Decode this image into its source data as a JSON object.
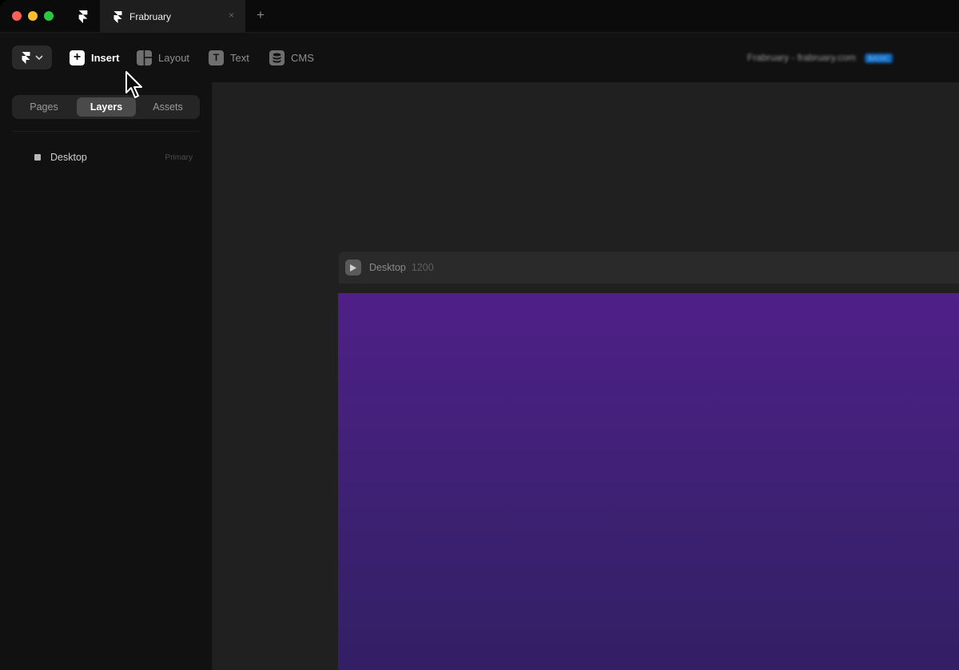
{
  "tabbar": {
    "doc_tab_label": "Frabruary",
    "close_glyph": "×",
    "new_tab_glyph": "+"
  },
  "toolbar": {
    "menu_chevron": "⌄",
    "insert_label": "Insert",
    "layout_label": "Layout",
    "text_label": "Text",
    "cms_label": "CMS",
    "text_icon_glyph": "T",
    "insert_icon_glyph": "+",
    "project_name": "Frabruary",
    "project_separator": " - ",
    "project_domain": "frabruary.com",
    "project_badge": "BASIC"
  },
  "sidebar": {
    "tabs": {
      "pages": "Pages",
      "layers": "Layers",
      "assets": "Assets"
    },
    "active_tab": "Layers",
    "layers": [
      {
        "name": "Desktop",
        "tag": "Primary"
      }
    ]
  },
  "canvas": {
    "frame_name": "Desktop",
    "frame_width_label": "1200"
  },
  "colors": {
    "accent_badge": "#0b63b6",
    "frame_top": "#4f2088",
    "frame_bottom": "#331f65"
  },
  "icons": [
    "framer-logo-icon",
    "chevron-down-icon",
    "plus-icon",
    "layout-icon",
    "text-icon",
    "cms-icon",
    "play-icon",
    "cursor-icon"
  ]
}
